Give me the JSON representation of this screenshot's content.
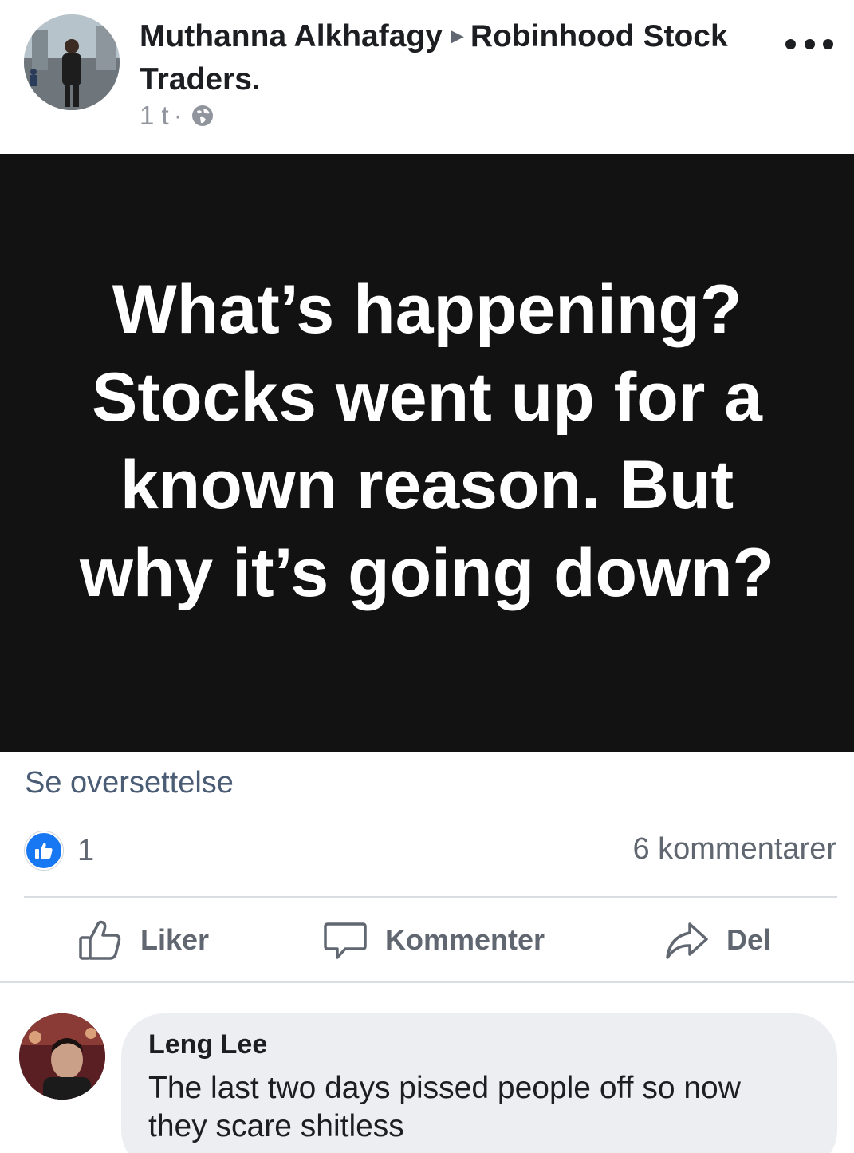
{
  "post": {
    "author": "Muthanna Alkhafagy",
    "group": "Robinhood Stock Traders.",
    "time": "1 t",
    "separator": "·",
    "status_text": "What’s happening? Stocks went up for a known reason. But why it’s going down?",
    "translate_label": "Se oversettelse"
  },
  "stats": {
    "reaction_count": "1",
    "comment_count": "6 kommentarer"
  },
  "actions": {
    "like_label": "Liker",
    "comment_label": "Kommenter",
    "share_label": "Del"
  },
  "comment": {
    "author": "Leng Lee",
    "text": "The last two days pissed people off so now they scare shitless"
  },
  "colors": {
    "like_blue": "#1877f2",
    "card_background": "#121212",
    "bubble": "#eceef1"
  }
}
